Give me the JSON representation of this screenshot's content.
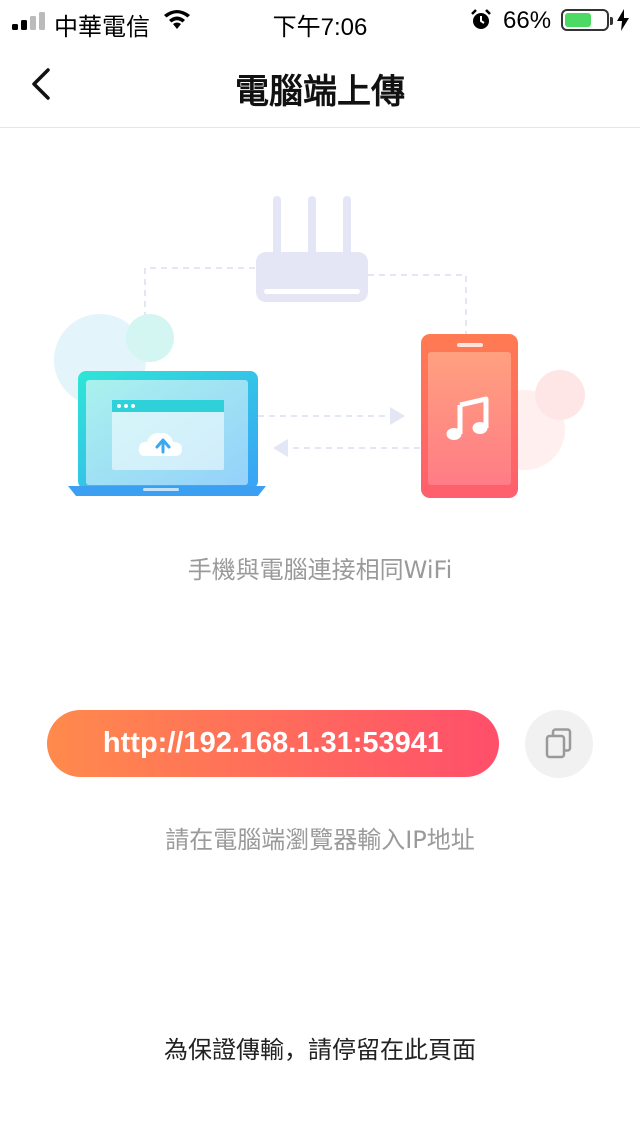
{
  "status_bar": {
    "carrier": "中華電信",
    "time": "下午7:06",
    "battery_percent": "66%",
    "battery_level": 0.66,
    "icons": [
      "signal-icon",
      "wifi-icon",
      "alarm-icon",
      "battery-icon",
      "charging-icon"
    ]
  },
  "nav": {
    "title": "電腦端上傳",
    "back_icon": "chevron-left-icon"
  },
  "illustration": {
    "icons": [
      "router-icon",
      "laptop-icon",
      "cloud-upload-icon",
      "phone-icon",
      "music-note-icon"
    ]
  },
  "main": {
    "wifi_hint": "手機與電腦連接相同WiFi",
    "url": "http://192.168.1.31:53941",
    "copy_icon": "copy-icon",
    "browser_hint": "請在電腦端瀏覽器輸入IP地址",
    "stay_notice": "為保證傳輸，請停留在此頁面"
  },
  "colors": {
    "accent_start": "#ff8a4c",
    "accent_end": "#ff4f6b",
    "laptop": "#36b8f4",
    "phone": "#ff6f5c",
    "router": "#e4e6f5"
  }
}
